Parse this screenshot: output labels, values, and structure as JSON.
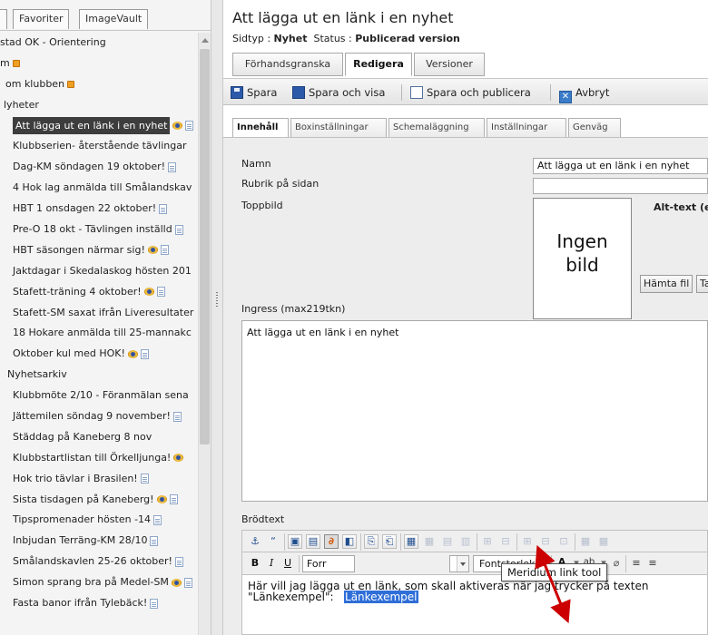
{
  "left_pane": {
    "tabs": [
      "Favoriter",
      "ImageVault"
    ],
    "tree": [
      {
        "label": "stad OK - Orientering",
        "indent": 0,
        "icons": []
      },
      {
        "label": "m",
        "indent": 0,
        "icons": [
          "flag"
        ]
      },
      {
        "label": "om klubben",
        "indent": 6,
        "icons": [
          "flag"
        ]
      },
      {
        "label": "lyheter",
        "indent": 4,
        "icons": []
      },
      {
        "label": "Att lägga ut en länk i en nyhet",
        "indent": 14,
        "icons": [
          "eye",
          "doc"
        ],
        "selected": true
      },
      {
        "label": "Klubbserien- återstående tävlingar",
        "indent": 14,
        "icons": []
      },
      {
        "label": "Dag-KM söndagen 19 oktober!",
        "indent": 14,
        "icons": [
          "doc"
        ]
      },
      {
        "label": "4 Hok lag anmälda till Smålandskav",
        "indent": 14,
        "icons": []
      },
      {
        "label": "HBT 1 onsdagen 22 oktober!",
        "indent": 14,
        "icons": [
          "doc"
        ]
      },
      {
        "label": "Pre-O 18 okt - Tävlingen inställd",
        "indent": 14,
        "icons": [
          "doc"
        ]
      },
      {
        "label": "HBT säsongen närmar sig!",
        "indent": 14,
        "icons": [
          "eye",
          "doc"
        ]
      },
      {
        "label": "Jaktdagar i Skedalaskog hösten 201",
        "indent": 14,
        "icons": []
      },
      {
        "label": "Stafett-träning 4 oktober!",
        "indent": 14,
        "icons": [
          "eye",
          "doc"
        ]
      },
      {
        "label": "Stafett-SM saxat ifrån Liveresultater",
        "indent": 14,
        "icons": []
      },
      {
        "label": "18 Hokare anmälda till 25-mannakc",
        "indent": 14,
        "icons": []
      },
      {
        "label": "Oktober kul med HOK!",
        "indent": 14,
        "icons": [
          "eye",
          "doc"
        ]
      },
      {
        "label": "Nyhetsarkiv",
        "indent": 8,
        "icons": []
      },
      {
        "label": "Klubbmöte 2/10 - Föranmälan sena",
        "indent": 14,
        "icons": []
      },
      {
        "label": "Jättemilen söndag 9 november!",
        "indent": 14,
        "icons": [
          "doc"
        ]
      },
      {
        "label": "Städdag på Kaneberg 8 nov",
        "indent": 14,
        "icons": []
      },
      {
        "label": "Klubbstartlistan till Örkelljunga!",
        "indent": 14,
        "icons": [
          "eye"
        ]
      },
      {
        "label": "Hok trio tävlar i Brasilen!",
        "indent": 14,
        "icons": [
          "doc"
        ]
      },
      {
        "label": "Sista tisdagen på Kaneberg!",
        "indent": 14,
        "icons": [
          "eye",
          "doc"
        ]
      },
      {
        "label": "Tipspromenader hösten -14",
        "indent": 14,
        "icons": [
          "doc"
        ]
      },
      {
        "label": "Inbjudan Terräng-KM 28/10",
        "indent": 14,
        "icons": [
          "doc"
        ]
      },
      {
        "label": "Smålandskavlen 25-26 oktober!",
        "indent": 14,
        "icons": [
          "doc"
        ]
      },
      {
        "label": "Simon sprang bra på Medel-SM",
        "indent": 14,
        "icons": [
          "eye",
          "doc"
        ]
      },
      {
        "label": "Fasta banor ifrån Tylebäck!",
        "indent": 14,
        "icons": [
          "doc"
        ]
      }
    ]
  },
  "header": {
    "title": "Att lägga ut en länk i en nyhet",
    "page_type_label": "Sidtyp : ",
    "page_type": "Nyhet",
    "status_label": "Status : ",
    "status": "Publicerad version"
  },
  "mode_tabs": [
    "Förhandsgranska",
    "Redigera",
    "Versioner"
  ],
  "toolbar": {
    "save": "Spara",
    "save_view": "Spara och visa",
    "save_publish": "Spara och publicera",
    "cancel": "Avbryt"
  },
  "sub_tabs": [
    "Innehåll",
    "Boxinställningar",
    "Schemaläggning",
    "Inställningar",
    "Genväg"
  ],
  "form": {
    "name_label": "Namn",
    "name_value": "Att lägga ut en länk i en nyhet",
    "heading_label": "Rubrik på sidan",
    "heading_value": "",
    "top_image_label": "Toppbild",
    "no_image_line1": "Ingen",
    "no_image_line2": "bild",
    "alt_text_label": "Alt-text (en",
    "fetch_button": "Hämta fil",
    "second_button": "Ta",
    "ingress_label": "Ingress (max219tkn)",
    "ingress_value": "Att lägga ut en länk i en nyhet",
    "body_label": "Brödtext"
  },
  "editor": {
    "bold": "B",
    "italic": "I",
    "underline": "U",
    "format_combo": "Forr",
    "fontsize_combo": "Fontstorlek",
    "tooltip": "Meridium link tool"
  },
  "body_text": {
    "line1": "Här vill jag lägga ut en länk, som skall aktiveras när jag trycker på texten",
    "line2_before": "\"Länkexempel\":",
    "line2_selected": "Länkexempel"
  },
  "colors": {
    "selection": "#2f6ed8",
    "tree_selected": "#3d3d3d",
    "arrow": "#cc0000"
  }
}
